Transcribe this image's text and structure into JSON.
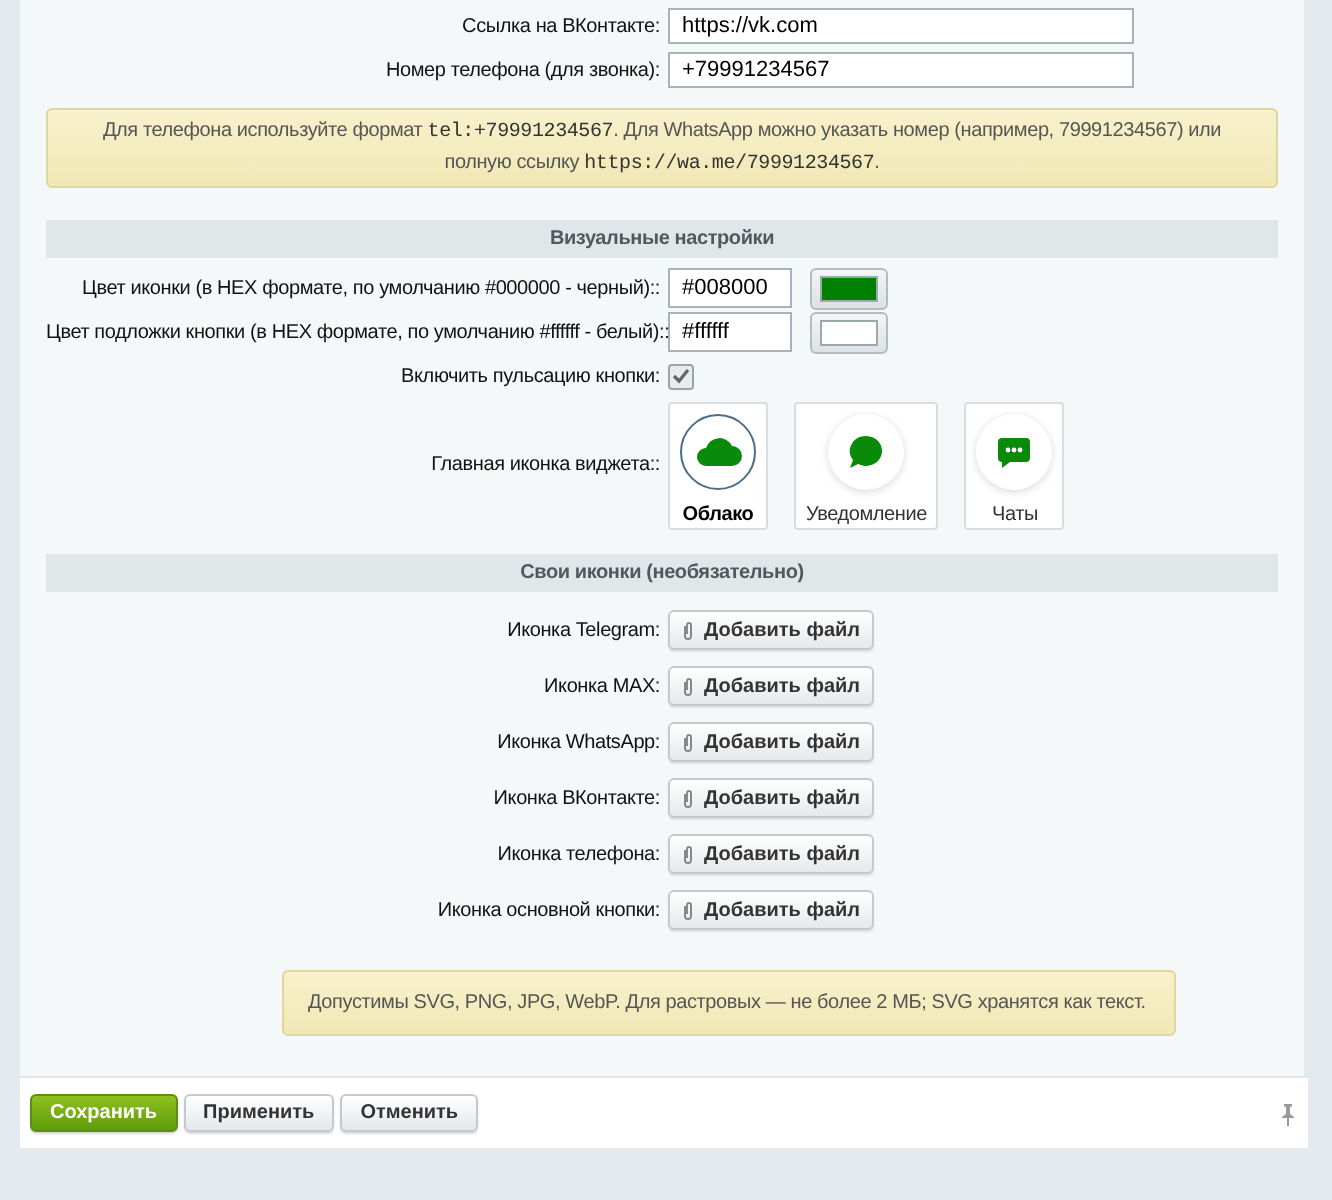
{
  "contact_fields": [
    {
      "label": "Ссылка на ВКонтакте:",
      "value": "https://vk.com"
    },
    {
      "label": "Номер телефона (для звонка):",
      "value": "+79991234567"
    }
  ],
  "contact_note": [
    {
      "kind": "text",
      "text": "Для телефона используйте формат "
    },
    {
      "kind": "code",
      "text": "tel:+79991234567"
    },
    {
      "kind": "text",
      "text": ". Для WhatsApp можно указать номер (например, 79991234567) или полную ссылку "
    },
    {
      "kind": "code",
      "text": "https://wa.me/79991234567"
    },
    {
      "kind": "text",
      "text": "."
    }
  ],
  "visual_settings": {
    "heading": "Визуальные настройки",
    "rows": [
      {
        "kind": "color",
        "label": "Цвет иконки (в HEX формате, по умолчанию #000000 - черный)::",
        "value": "#008000",
        "color": "#008000"
      },
      {
        "kind": "color",
        "label": "Цвет подложки кнопки (в HEX формате, по умолчанию #ffffff - белый)::",
        "value": "#ffffff",
        "color": "#ffffff"
      },
      {
        "kind": "checkbox",
        "label": "Включить пульсацию кнопки:",
        "checked": true
      },
      {
        "kind": "icon_choice",
        "label": "Главная иконка виджета::",
        "options": [
          {
            "kind": "cloud",
            "label": "Облако",
            "selected": true
          },
          {
            "kind": "bubble",
            "label": "Уведомление",
            "selected": false
          },
          {
            "kind": "chat",
            "label": "Чаты",
            "selected": false
          }
        ]
      }
    ]
  },
  "custom_icons": {
    "heading": "Свои иконки (необязательно)",
    "rows": [
      {
        "label": "Иконка Telegram:",
        "button": "Добавить файл"
      },
      {
        "label": "Иконка MAX:",
        "button": "Добавить файл"
      },
      {
        "label": "Иконка WhatsApp:",
        "button": "Добавить файл"
      },
      {
        "label": "Иконка ВКонтакте:",
        "button": "Добавить файл"
      },
      {
        "label": "Иконка телефона:",
        "button": "Добавить файл"
      },
      {
        "label": "Иконка основной кнопки:",
        "button": "Добавить файл"
      }
    ],
    "note": "Допустимы SVG, PNG, JPG, WebP. Для растровых — не более 2 МБ; SVG хранятся как текст."
  },
  "footer_buttons": [
    {
      "kind": "primary",
      "label": "Сохранить"
    },
    {
      "kind": "default",
      "label": "Применить"
    },
    {
      "kind": "default",
      "label": "Отменить"
    }
  ]
}
